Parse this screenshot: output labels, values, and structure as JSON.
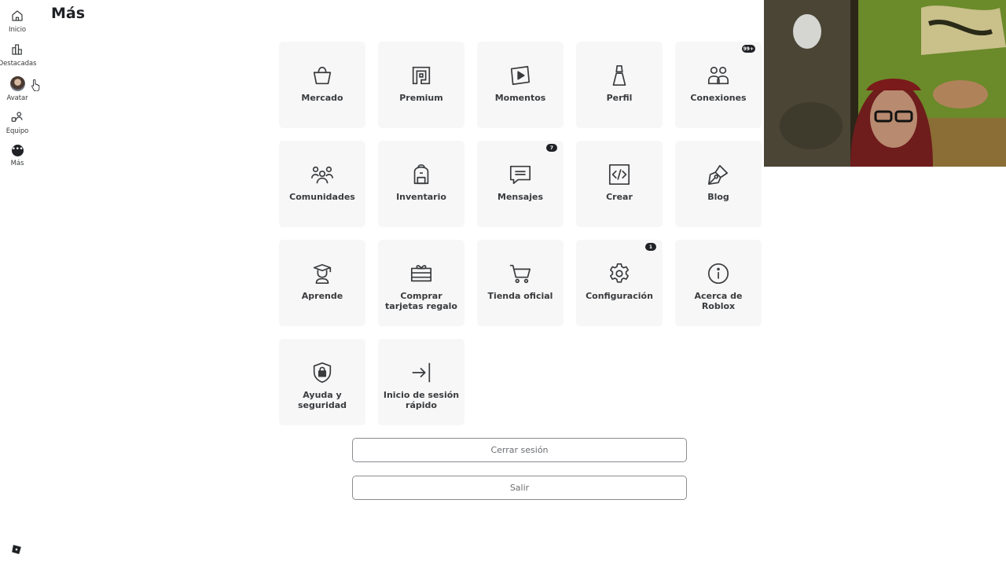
{
  "sidebar": {
    "items": [
      {
        "label": "Inicio",
        "icon": "home-icon"
      },
      {
        "label": "Destacadas",
        "icon": "charts-icon"
      },
      {
        "label": "Avatar",
        "icon": "avatar-icon"
      },
      {
        "label": "Equipo",
        "icon": "team-icon"
      },
      {
        "label": "Más",
        "icon": "more-icon"
      }
    ]
  },
  "page": {
    "title": "Más"
  },
  "tiles": [
    {
      "label": "Mercado",
      "icon": "shopping-bag-icon",
      "badge": ""
    },
    {
      "label": "Premium",
      "icon": "premium-icon",
      "badge": ""
    },
    {
      "label": "Momentos",
      "icon": "play-icon",
      "badge": ""
    },
    {
      "label": "Perfil",
      "icon": "profile-icon",
      "badge": ""
    },
    {
      "label": "Conexiones",
      "icon": "connections-icon",
      "badge": "99+"
    },
    {
      "label": "Comunidades",
      "icon": "communities-icon",
      "badge": ""
    },
    {
      "label": "Inventario",
      "icon": "backpack-icon",
      "badge": ""
    },
    {
      "label": "Mensajes",
      "icon": "message-icon",
      "badge": "7"
    },
    {
      "label": "Crear",
      "icon": "code-icon",
      "badge": ""
    },
    {
      "label": "Blog",
      "icon": "pen-icon",
      "badge": ""
    },
    {
      "label": "Aprende",
      "icon": "learn-icon",
      "badge": ""
    },
    {
      "label": "Comprar tarjetas regalo",
      "icon": "gift-card-icon",
      "badge": ""
    },
    {
      "label": "Tienda oficial",
      "icon": "cart-icon",
      "badge": ""
    },
    {
      "label": "Configuración",
      "icon": "gear-icon",
      "badge": "1"
    },
    {
      "label": "Acerca de Roblox",
      "icon": "info-icon",
      "badge": ""
    },
    {
      "label": "Ayuda y seguridad",
      "icon": "shield-lock-icon",
      "badge": ""
    },
    {
      "label": "Inicio de sesión rápido",
      "icon": "login-icon",
      "badge": ""
    }
  ],
  "buttons": {
    "logout": "Cerrar sesión",
    "exit": "Salir"
  },
  "colors": {
    "tile_bg": "#f7f7f8",
    "text": "#393b3d",
    "badge": "#1f2125"
  }
}
